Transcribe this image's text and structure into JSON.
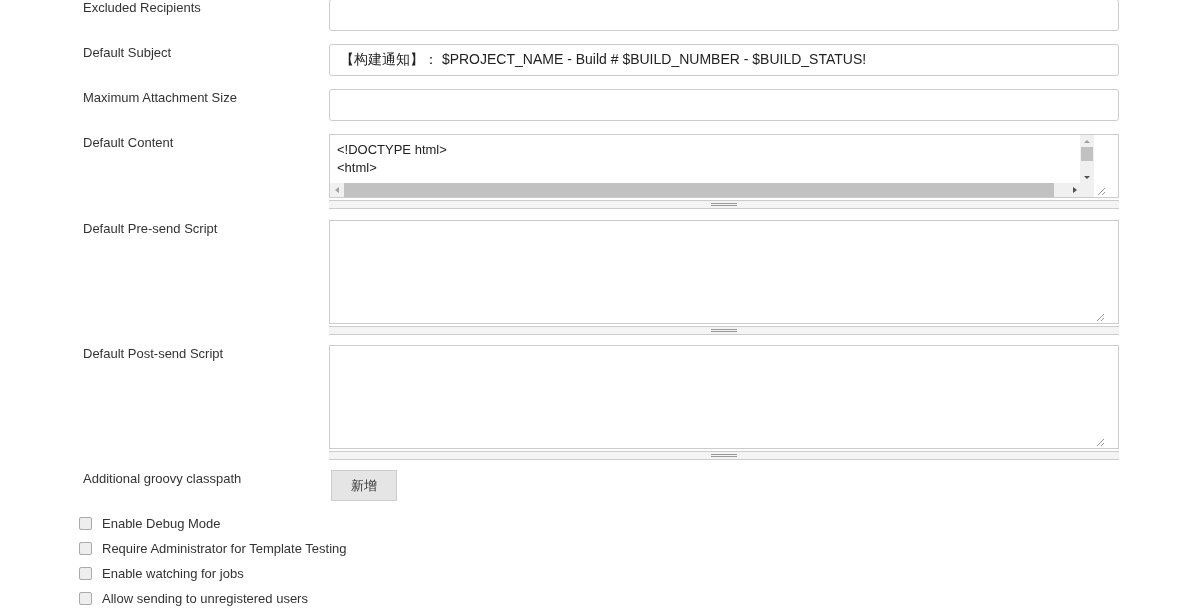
{
  "fields": [
    {
      "label": "Excluded Recipients",
      "kind": "text"
    },
    {
      "label": "Default Subject",
      "kind": "text",
      "value": "【构建通知】： $PROJECT_NAME - Build # $BUILD_NUMBER - $BUILD_STATUS!"
    },
    {
      "label": "Maximum Attachment Size",
      "kind": "text"
    },
    {
      "label": "Default Content",
      "kind": "code",
      "lines": [
        "<!DOCTYPE html>",
        "<html>"
      ]
    },
    {
      "label": "Default Pre-send Script",
      "kind": "textarea"
    },
    {
      "label": "Default Post-send Script",
      "kind": "textarea"
    },
    {
      "label": "Additional groovy classpath",
      "kind": "button",
      "button": "新增"
    }
  ],
  "checkboxes": [
    {
      "label": "Enable Debug Mode",
      "checked": false
    },
    {
      "label": "Require Administrator for Template Testing",
      "checked": false
    },
    {
      "label": "Enable watching for jobs",
      "checked": false
    },
    {
      "label": "Allow sending to unregistered users",
      "checked": false
    }
  ]
}
